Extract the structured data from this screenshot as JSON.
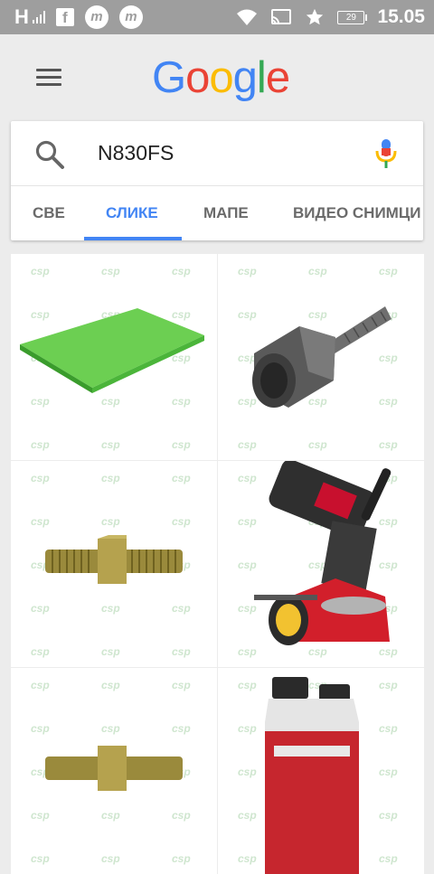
{
  "status_bar": {
    "network_label": "H",
    "battery_level": "29",
    "time": "15.05",
    "icons": [
      "signal-icon",
      "facebook-icon",
      "m-app-icon",
      "m-app-icon-2",
      "wifi-icon",
      "cast-icon",
      "star-icon",
      "battery-icon"
    ]
  },
  "header": {
    "logo_letters": [
      {
        "char": "G",
        "color": "#4285F4"
      },
      {
        "char": "o",
        "color": "#EA4335"
      },
      {
        "char": "o",
        "color": "#FBBC05"
      },
      {
        "char": "g",
        "color": "#4285F4"
      },
      {
        "char": "l",
        "color": "#34A853"
      },
      {
        "char": "e",
        "color": "#EA4335"
      }
    ]
  },
  "search": {
    "query": "N830FS"
  },
  "tabs": [
    {
      "label": "СВЕ",
      "active": false
    },
    {
      "label": "СЛИКЕ",
      "active": true
    },
    {
      "label": "МАПЕ",
      "active": false
    },
    {
      "label": "ВИДЕО СНИМЦИ",
      "active": false
    }
  ],
  "colors": {
    "accent": "#4285f4",
    "status_bar": "#9e9e9e",
    "background": "#ececec"
  },
  "results": [
    {
      "subject": "green-plate"
    },
    {
      "subject": "threaded-adapter"
    },
    {
      "subject": "double-threaded-stud"
    },
    {
      "subject": "chain-sharpener"
    },
    {
      "subject": "double-threaded-stud-2"
    },
    {
      "subject": "oil-bottle"
    }
  ]
}
